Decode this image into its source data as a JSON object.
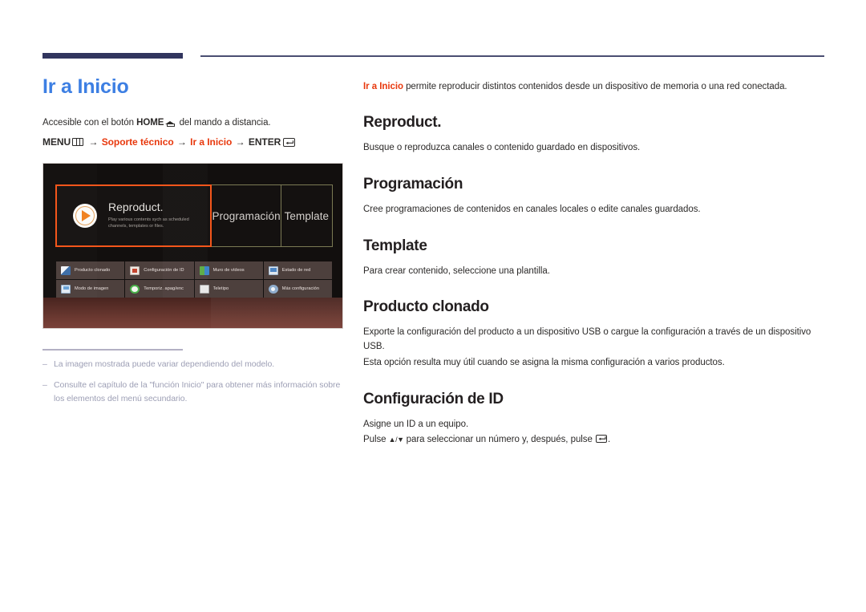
{
  "page": {
    "title": "Ir a Inicio",
    "accent_color": "#e8380d",
    "title_color": "#3d7fe3",
    "rule_color": "#31355e"
  },
  "left": {
    "access_prefix": "Accesible con el botón ",
    "access_bold": "HOME",
    "access_suffix": " del mando a distancia.",
    "menu_path": {
      "menu_label": "MENU",
      "arrow1": "→",
      "item1": "Soporte técnico",
      "arrow2": "→",
      "item2": "Ir a Inicio",
      "arrow3": "→",
      "enter_label": "ENTER"
    },
    "notes": [
      {
        "dash": "–",
        "text": "La imagen mostrada puede variar dependiendo del modelo."
      },
      {
        "dash": "–",
        "text": "Consulte el capítulo de la \"función Inicio\" para obtener más información sobre los elementos del menú secundario."
      }
    ]
  },
  "tv_screenshot": {
    "tiles": [
      {
        "label": "Reproduct.",
        "subtitle": "Play various contents sych as scheduled channels, templates or files.",
        "selected": true,
        "icon": "play-icon",
        "border_color": "#f4561b"
      },
      {
        "label": "Programación",
        "selected": false,
        "border_color": "#7b7a54"
      },
      {
        "label": "Template",
        "selected": false,
        "border_color": "#7b7a54"
      }
    ],
    "grid_items": [
      {
        "label": "Producto clonado",
        "icon": "clone-product-icon",
        "color": "#e4ecf6"
      },
      {
        "label": "Configuración de ID",
        "icon": "id-settings-icon",
        "color": "#e8e2dc"
      },
      {
        "label": "Muro de vídeos",
        "icon": "video-wall-icon",
        "color": "#4f9f3c"
      },
      {
        "label": "Estado de red",
        "icon": "network-status-icon",
        "color": "#5b8fc7"
      },
      {
        "label": "Modo de imagen",
        "icon": "picture-mode-icon",
        "color": "#6ba3d6"
      },
      {
        "label": "Temporiz. apag/enc",
        "icon": "on-off-timer-icon",
        "color": "#49b24a"
      },
      {
        "label": "Teletipo",
        "icon": "ticker-icon",
        "color": "#dcdcdc"
      },
      {
        "label": "Más configuración",
        "icon": "more-settings-icon",
        "color": "#7e9fc4"
      }
    ]
  },
  "right": {
    "intro_accent": "Ir a Inicio",
    "intro_rest": " permite reproducir distintos contenidos desde un dispositivo de memoria o una red conectada.",
    "sections": [
      {
        "heading": "Reproduct.",
        "paragraphs": [
          "Busque o reproduzca canales o contenido guardado en dispositivos."
        ]
      },
      {
        "heading": "Programación",
        "paragraphs": [
          "Cree programaciones de contenidos en canales locales o edite canales guardados."
        ]
      },
      {
        "heading": "Template",
        "paragraphs": [
          "Para crear contenido, seleccione una plantilla."
        ]
      },
      {
        "heading": "Producto clonado",
        "paragraphs": [
          "Exporte la configuración del producto a un dispositivo USB o cargue la configuración a través de un dispositivo USB.",
          "Esta opción resulta muy útil cuando se asigna la misma configuración a varios productos."
        ]
      },
      {
        "heading": "Configuración de ID",
        "paragraphs": [
          "Asigne un ID a un equipo."
        ],
        "press_prefix": "Pulse ",
        "press_updown": "▲/▼",
        "press_mid": " para seleccionar un número y, después, pulse ",
        "press_suffix": "."
      }
    ]
  }
}
